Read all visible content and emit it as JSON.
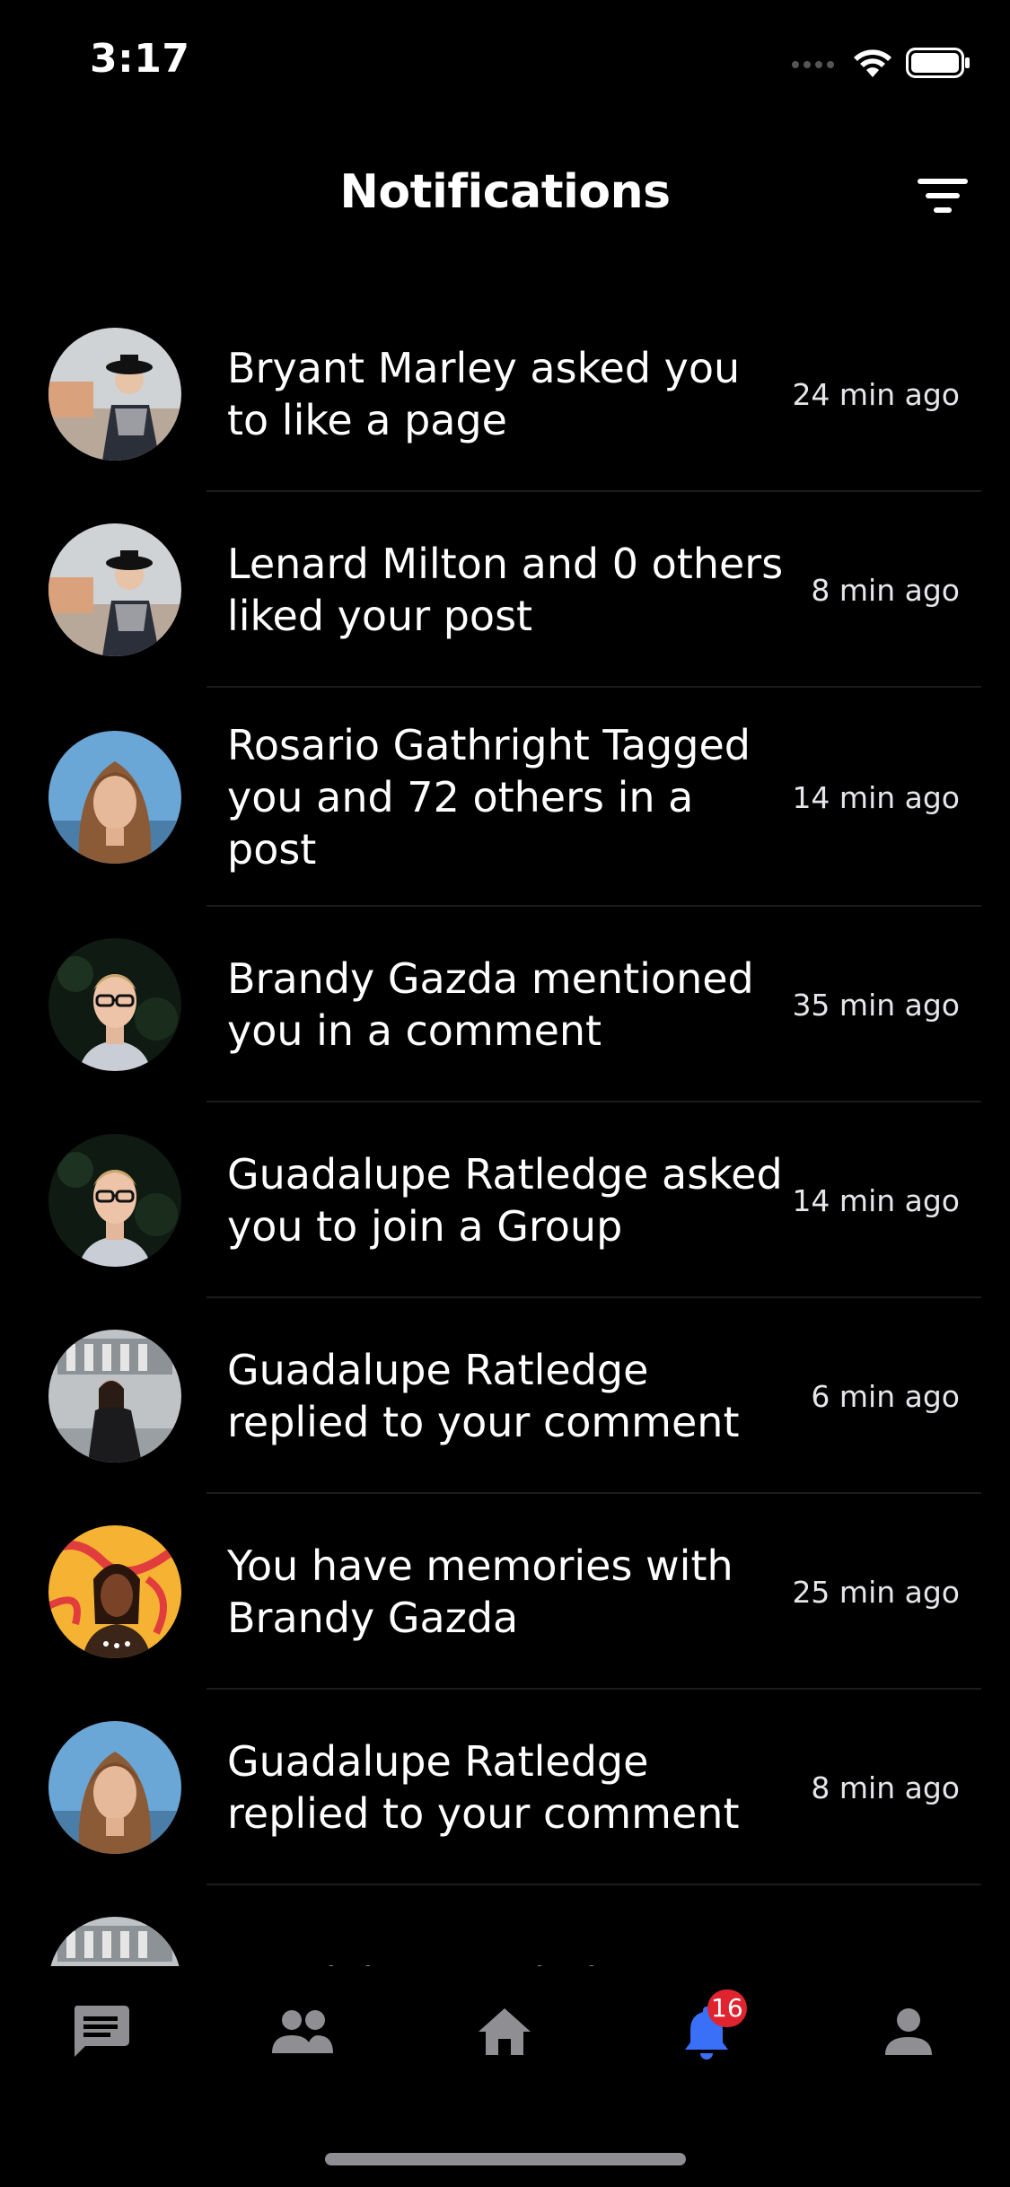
{
  "status_bar": {
    "time": "3:17",
    "icons": [
      "signal-icon",
      "wifi-icon",
      "battery-icon"
    ]
  },
  "header": {
    "title": "Notifications",
    "filter_icon": "filter-icon"
  },
  "notifications": [
    {
      "text": "Bryant Marley asked you to like a page",
      "time": "24 min ago"
    },
    {
      "text": "Lenard Milton and 0 others liked your post",
      "time": "8 min ago"
    },
    {
      "text": "Rosario Gathright Tagged you and 72 others in a post",
      "time": "14 min ago"
    },
    {
      "text": "Brandy Gazda mentioned you in a comment",
      "time": "35 min ago"
    },
    {
      "text": "Guadalupe Ratledge asked you to join a Group",
      "time": "14 min ago"
    },
    {
      "text": "Guadalupe Ratledge replied to your comment",
      "time": "6 min ago"
    },
    {
      "text": "You have memories with Brandy Gazda",
      "time": "25 min ago"
    },
    {
      "text": "Guadalupe Ratledge replied to your comment",
      "time": "8 min ago"
    },
    {
      "text": "Guadalupe Ratledge",
      "time": ""
    }
  ],
  "tab_bar": {
    "tabs": [
      {
        "name": "chat-icon"
      },
      {
        "name": "friends-icon"
      },
      {
        "name": "home-icon"
      },
      {
        "name": "notifications-icon",
        "badge": "16"
      },
      {
        "name": "profile-icon"
      }
    ],
    "active_color": "#3a6ff7",
    "inactive_color": "#8e8e93"
  },
  "colors": {
    "background": "#000000",
    "text": "#ffffff",
    "badge": "#e0242f",
    "separator": "#1c1c1e"
  }
}
